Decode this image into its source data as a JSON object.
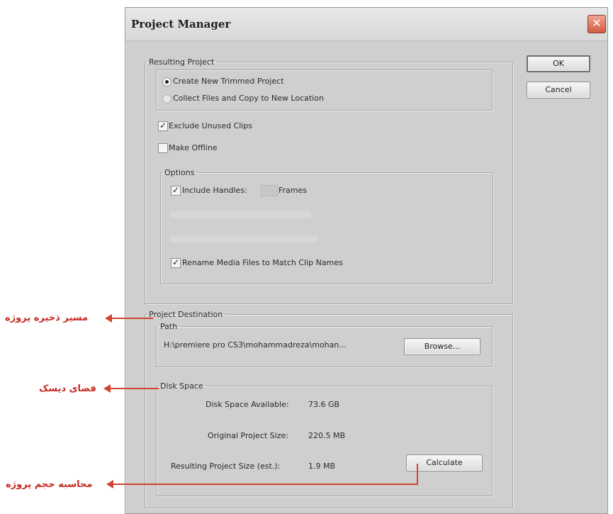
{
  "dialog": {
    "title": "Project Manager",
    "close_symbol": "✕",
    "ok_label": "OK",
    "cancel_label": "Cancel"
  },
  "resulting_project": {
    "legend": "Resulting Project",
    "options": [
      {
        "label": "Create New Trimmed Project",
        "selected": true
      },
      {
        "label": "Collect Files and Copy to New Location",
        "selected": false
      }
    ]
  },
  "exclude_unused": {
    "label": "Exclude Unused Clips",
    "checked": true
  },
  "make_offline": {
    "label": "Make Offline",
    "checked": false
  },
  "options": {
    "legend": "Options",
    "include_handles": {
      "label": "Include Handles:",
      "frames_label": "Frames",
      "checked": true
    },
    "rename_media": {
      "label": "Rename Media Files to Match Clip Names",
      "checked": true
    }
  },
  "destination": {
    "legend": "Project Destination",
    "path_legend": "Path",
    "path_value": "H:\\premiere pro CS3\\mohammadreza\\mohan...",
    "browse_label": "Browse..."
  },
  "disk_space": {
    "legend": "Disk Space",
    "available_label": "Disk Space Available:",
    "available_value": "73.6 GB",
    "original_label": "Original Project Size:",
    "original_value": "220.5 MB",
    "resulting_label": "Resulting Project Size (est.):",
    "resulting_value": "1.9 MB",
    "calculate_label": "Calculate"
  },
  "annotations": {
    "destination": "مسیر ذخیره پروژه",
    "disk_space": "فضای دیسک",
    "calculate": "محاسبه حجم پروژه"
  },
  "colors": {
    "annotation": "#c62a22",
    "dialog_bg": "#cfcfcf"
  },
  "icons": {
    "close": "close-icon",
    "check": "check-icon",
    "radio": "radio-icon",
    "arrow": "arrow-left-icon"
  }
}
